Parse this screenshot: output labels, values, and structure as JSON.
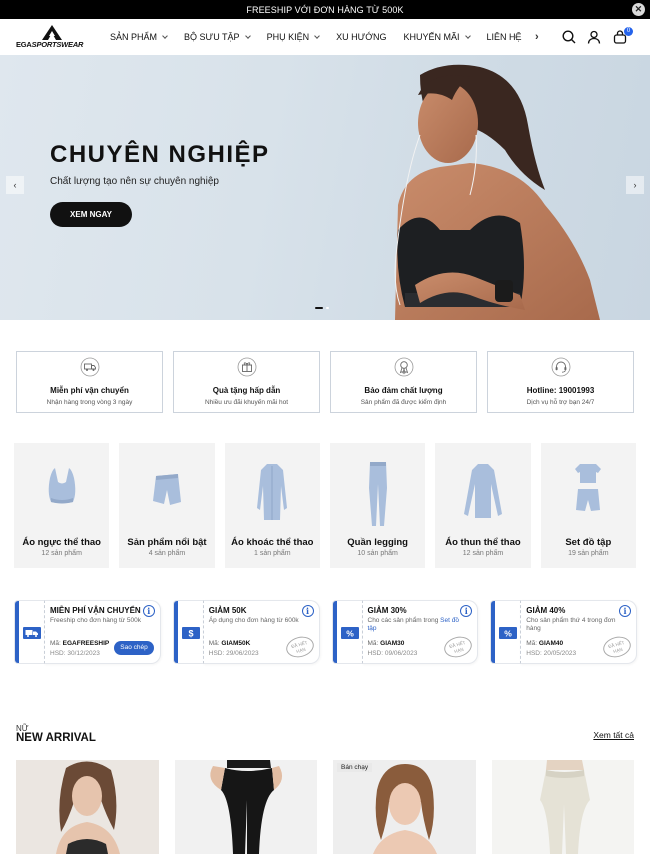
{
  "announcement": {
    "text": "FREESHIP VỚI ĐƠN HÀNG TỪ 500K",
    "close": "✕"
  },
  "header": {
    "logo_text_1": "EGA",
    "logo_text_2": "SPORTSWEAR",
    "nav": [
      "SẢN PHẨM",
      "BỘ SƯU TẬP",
      "PHỤ KIỆN",
      "XU HƯỚNG",
      "KHUYẾN MÃI",
      "LIÊN HỆ"
    ],
    "nav_has_dropdown": [
      true,
      true,
      true,
      false,
      true,
      false
    ],
    "prev": "‹",
    "next": "›",
    "cart_count": "0",
    "icons": [
      "search-icon",
      "user-icon",
      "cart-icon"
    ]
  },
  "hero": {
    "title": "CHUYÊN NGHIỆP",
    "subtitle": "Chất lượng tạo nên sự chuyên nghiệp",
    "button": "XEM NGAY",
    "prev": "‹",
    "next": "›",
    "active_slide": 1,
    "slide_count": 2
  },
  "features": [
    {
      "icon": "delivery-icon",
      "title": "Miễn phí vận chuyển",
      "subtitle": "Nhận hàng trong vòng 3 ngày"
    },
    {
      "icon": "gift-icon",
      "title": "Quà tặng hấp dẫn",
      "subtitle": "Nhiều ưu đãi khuyến mãi hot"
    },
    {
      "icon": "quality-badge-icon",
      "title": "Bảo đảm chất lượng",
      "subtitle": "Sản phẩm đã được kiểm định"
    },
    {
      "icon": "support-icon",
      "title": "Hotline: 19001993",
      "subtitle": "Dịch vụ hỗ trợ bạn 24/7"
    }
  ],
  "categories": [
    {
      "name": "Áo ngực thể thao",
      "count": "12 sản phẩm"
    },
    {
      "name": "Sản phẩm nổi bật",
      "count": "4 sản phẩm"
    },
    {
      "name": "Áo khoác thể thao",
      "count": "1 sản phẩm"
    },
    {
      "name": "Quần legging",
      "count": "10 sản phẩm"
    },
    {
      "name": "Áo thun thể thao",
      "count": "12 sản phẩm"
    },
    {
      "name": "Set đồ tập",
      "count": "19 sản phẩm"
    }
  ],
  "coupons": [
    {
      "icon": "truck-icon",
      "title": "MIỄN PHÍ VẬN CHUYỂN",
      "desc": "Freeship cho đơn hàng từ 500k",
      "code_label": "Mã:",
      "code": "EGAFREESHIP",
      "expiry": "HSD: 30/12/2023",
      "action": "Sao chép",
      "expired": false
    },
    {
      "icon": "dollar-icon",
      "title": "GIẢM 50K",
      "desc": "Áp dụng cho đơn hàng từ 600k",
      "code_label": "Mã:",
      "code": "GIAM50K",
      "expiry": "HSD: 29/06/2023",
      "stamp": "ĐÃ HẾT HẠN",
      "expired": true
    },
    {
      "icon": "percent-icon",
      "title": "GIẢM 30%",
      "desc": "Cho các sản phẩm trong",
      "desc_link": "Set đồ tập",
      "code_label": "Mã:",
      "code": "GIAM30",
      "expiry": "HSD: 09/06/2023",
      "stamp": "ĐÃ HẾT HẠN",
      "expired": true
    },
    {
      "icon": "percent-icon",
      "title": "GIẢM 40%",
      "desc": "Cho sản phẩm thứ 4 trong đơn hàng",
      "code_label": "Mã:",
      "code": "GIAM40",
      "expiry": "HSD: 20/05/2023",
      "stamp": "ĐÃ HẾT HẠN",
      "expired": true
    }
  ],
  "new_arrival": {
    "eyebrow": "NỮ",
    "title": "NEW ARRIVAL",
    "see_all": "Xem tất cả",
    "products": [
      {
        "tag": ""
      },
      {
        "tag": ""
      },
      {
        "tag": "Bán chạy"
      },
      {
        "tag": ""
      }
    ]
  },
  "colors": {
    "accent": "#2d62c6",
    "topbar": "#000000",
    "cart_badge": "#2563eb"
  }
}
